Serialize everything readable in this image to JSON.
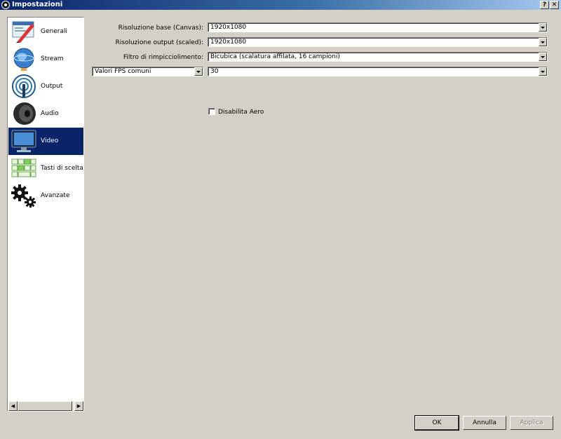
{
  "window": {
    "title": "Impostazioni",
    "help_label": "?",
    "close_label": "✕"
  },
  "sidebar": {
    "items": [
      {
        "label": "Generali",
        "icon": "general-settings-icon"
      },
      {
        "label": "Stream",
        "icon": "stream-globe-icon"
      },
      {
        "label": "Output",
        "icon": "output-broadcast-icon"
      },
      {
        "label": "Audio",
        "icon": "speaker-icon"
      },
      {
        "label": "Video",
        "icon": "monitor-icon",
        "selected": true
      },
      {
        "label": "Tasti di scelta rapida",
        "icon": "hotkeys-keyboard-icon"
      },
      {
        "label": "Avanzate",
        "icon": "gears-icon"
      }
    ],
    "scroll_left": "◀",
    "scroll_right": "▶"
  },
  "video": {
    "base_resolution": {
      "label": "Risoluzione base (Canvas):",
      "value": "1920x1080"
    },
    "output_resolution": {
      "label": "Risoluzione output (scaled):",
      "value": "1920x1080"
    },
    "downscale_filter": {
      "label": "Filtro di rimpicciolimento:",
      "value": "Bicubica (scalatura affilata, 16 campioni)"
    },
    "fps_type": {
      "value": "Valori FPS comuni"
    },
    "fps_value": {
      "value": "30"
    },
    "disable_aero": {
      "label": "Disabilita Aero",
      "checked": false
    }
  },
  "buttons": {
    "ok": "OK",
    "cancel": "Annulla",
    "apply": "Applica"
  },
  "colors": {
    "selection": "#0a246a",
    "face": "#d4d0c8"
  }
}
